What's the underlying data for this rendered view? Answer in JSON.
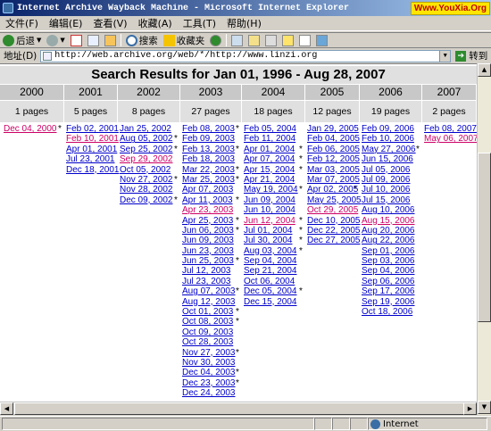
{
  "window": {
    "title": "Internet Archive Wayback Machine - Microsoft Internet Explorer",
    "watermark": "Www.YouXia.Org"
  },
  "menu": [
    "文件(F)",
    "编辑(E)",
    "查看(V)",
    "收藏(A)",
    "工具(T)",
    "帮助(H)"
  ],
  "toolbar": {
    "back": "后退",
    "search": "搜索",
    "favorites": "收藏夹"
  },
  "address": {
    "label": "地址(D)",
    "url": "http://web.archive.org/web/*/http://www.linzi.org",
    "go": "转到"
  },
  "status": {
    "zone": "Internet"
  },
  "page": {
    "title": "Search Results for Jan 01, 1996 - Aug 28, 2007"
  },
  "colors": {
    "link": "#0000cc",
    "visited": "#cc0066",
    "year_bg": "#c8c8c8",
    "pages_bg": "#e0e0e0"
  },
  "years": [
    {
      "year": "2000",
      "pages": "1 pages",
      "dates": [
        {
          "t": "Dec 04, 2000",
          "v": true,
          "s": true
        }
      ]
    },
    {
      "year": "2001",
      "pages": "5 pages",
      "dates": [
        {
          "t": "Feb 02, 2001"
        },
        {
          "t": "Feb 10, 2001",
          "v": true
        },
        {
          "t": "Apr 01, 2001"
        },
        {
          "t": "Jul 23, 2001"
        },
        {
          "t": "Dec 18, 2001"
        }
      ]
    },
    {
      "year": "2002",
      "pages": "8 pages",
      "dates": [
        {
          "t": "Jan 25, 2002"
        },
        {
          "t": "Aug 05, 2002",
          "s": true
        },
        {
          "t": "Sep 25, 2002",
          "s": true
        },
        {
          "t": "Sep 29, 2002",
          "v": true
        },
        {
          "t": "Oct 05, 2002"
        },
        {
          "t": "Nov 27, 2002",
          "s": true
        },
        {
          "t": "Nov 28, 2002"
        },
        {
          "t": "Dec 09, 2002",
          "s": true
        }
      ]
    },
    {
      "year": "2003",
      "pages": "27 pages",
      "dates": [
        {
          "t": "Feb 08, 2003",
          "s": true
        },
        {
          "t": "Feb 09, 2003"
        },
        {
          "t": "Feb 13, 2003",
          "s": true
        },
        {
          "t": "Feb 18, 2003"
        },
        {
          "t": "Mar 22, 2003",
          "s": true
        },
        {
          "t": "Mar 25, 2003",
          "s": true
        },
        {
          "t": "Apr 07, 2003"
        },
        {
          "t": "Apr 11, 2003",
          "s": true
        },
        {
          "t": "Apr 23, 2003",
          "v": true
        },
        {
          "t": "Apr 25, 2003",
          "s": true
        },
        {
          "t": "Jun 06, 2003",
          "s": true
        },
        {
          "t": "Jun 09, 2003"
        },
        {
          "t": "Jun 23, 2003"
        },
        {
          "t": "Jun 25, 2003",
          "s": true
        },
        {
          "t": "Jul 12, 2003"
        },
        {
          "t": "Jul 23, 2003"
        },
        {
          "t": "Aug 07, 2003",
          "s": true
        },
        {
          "t": "Aug 12, 2003"
        },
        {
          "t": "Oct 01, 2003",
          "s": true
        },
        {
          "t": "Oct 08, 2003",
          "s": true
        },
        {
          "t": "Oct 09, 2003"
        },
        {
          "t": "Oct 28, 2003"
        },
        {
          "t": "Nov 27, 2003",
          "s": true
        },
        {
          "t": "Nov 30, 2003"
        },
        {
          "t": "Dec 04, 2003",
          "s": true
        },
        {
          "t": "Dec 23, 2003",
          "s": true
        },
        {
          "t": "Dec 24, 2003"
        }
      ]
    },
    {
      "year": "2004",
      "pages": "18 pages",
      "dates": [
        {
          "t": "Feb 05, 2004"
        },
        {
          "t": "Feb 11, 2004"
        },
        {
          "t": "Apr 01, 2004",
          "s": true
        },
        {
          "t": "Apr 07, 2004",
          "s": true
        },
        {
          "t": "Apr 15, 2004",
          "s": true
        },
        {
          "t": "Apr 21, 2004"
        },
        {
          "t": "May 19, 2004",
          "s": true
        },
        {
          "t": "Jun 09, 2004"
        },
        {
          "t": "Jun 10, 2004"
        },
        {
          "t": "Jun 12, 2004",
          "v": true,
          "s": true
        },
        {
          "t": "Jul 01, 2004",
          "s": true
        },
        {
          "t": "Jul 30, 2004",
          "s": true
        },
        {
          "t": "Aug 03, 2004",
          "s": true
        },
        {
          "t": "Sep 04, 2004"
        },
        {
          "t": "Sep 21, 2004"
        },
        {
          "t": "Oct 06, 2004"
        },
        {
          "t": "Dec 05, 2004",
          "s": true
        },
        {
          "t": "Dec 15, 2004"
        }
      ]
    },
    {
      "year": "2005",
      "pages": "12 pages",
      "dates": [
        {
          "t": "Jan 29, 2005"
        },
        {
          "t": "Feb 04, 2005"
        },
        {
          "t": "Feb 06, 2005"
        },
        {
          "t": "Feb 12, 2005"
        },
        {
          "t": "Mar 03, 2005"
        },
        {
          "t": "Mar 07, 2005"
        },
        {
          "t": "Apr 02, 2005",
          "s": true
        },
        {
          "t": "May 25, 2005"
        },
        {
          "t": "Oct 29, 2005",
          "v": true
        },
        {
          "t": "Dec 10, 2005"
        },
        {
          "t": "Dec 22, 2005"
        },
        {
          "t": "Dec 27, 2005"
        }
      ]
    },
    {
      "year": "2006",
      "pages": "19 pages",
      "dates": [
        {
          "t": "Feb 09, 2006"
        },
        {
          "t": "Feb 10, 2006"
        },
        {
          "t": "May 27, 2006",
          "s": true
        },
        {
          "t": "Jun 15, 2006"
        },
        {
          "t": "Jul 05, 2006"
        },
        {
          "t": "Jul 09, 2006"
        },
        {
          "t": "Jul 10, 2006"
        },
        {
          "t": "Jul 15, 2006"
        },
        {
          "t": "Aug 10, 2006"
        },
        {
          "t": "Aug 15, 2006",
          "v": true
        },
        {
          "t": "Aug 20, 2006"
        },
        {
          "t": "Aug 22, 2006"
        },
        {
          "t": "Sep 01, 2006"
        },
        {
          "t": "Sep 03, 2006"
        },
        {
          "t": "Sep 04, 2006"
        },
        {
          "t": "Sep 06, 2006"
        },
        {
          "t": "Sep 17, 2006"
        },
        {
          "t": "Sep 19, 2006"
        },
        {
          "t": "Oct 18, 2006"
        }
      ]
    },
    {
      "year": "2007",
      "pages": "2 pages",
      "dates": [
        {
          "t": "Feb 08, 2007"
        },
        {
          "t": "May 06, 2007",
          "v": true
        }
      ]
    }
  ]
}
